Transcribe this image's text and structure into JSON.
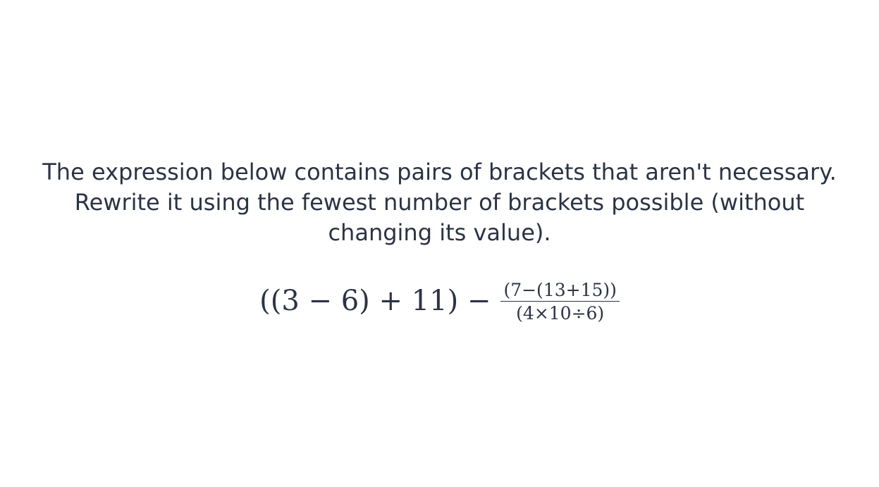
{
  "question": {
    "line1": "The expression below contains pairs of brackets that aren't necessary.",
    "line2": "Rewrite it using the fewest number of brackets possible (without",
    "line3": "changing its value)."
  },
  "expression": {
    "lhs": "((3 − 6) + 11) −",
    "numerator": "(7−(13+15))",
    "denominator": "(4×10÷6)"
  }
}
